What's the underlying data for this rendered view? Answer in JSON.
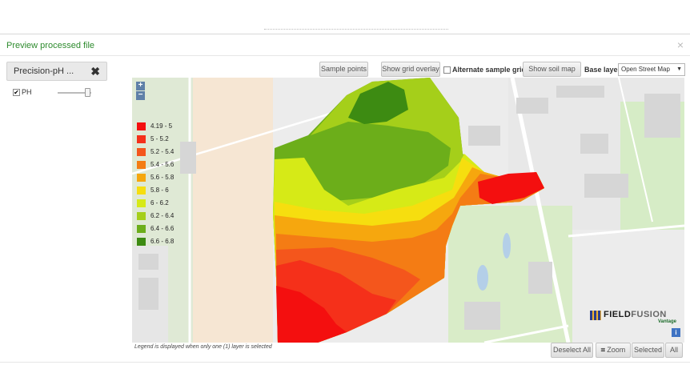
{
  "modal": {
    "title": "Preview processed file",
    "close_glyph": "×"
  },
  "layer": {
    "name": "Precision-pH ...",
    "remove_glyph": "✖",
    "checkbox_label": "PH",
    "checkbox_checked": true
  },
  "toolbar": {
    "sample_points": "Sample points",
    "show_grid_overlay": "Show grid overlay",
    "alternate_sample_grid": "Alternate sample grid",
    "show_soil_map": "Show soil map",
    "base_layer_label": "Base layer:",
    "base_layer_value": "Open Street Map"
  },
  "map": {
    "zoom_in": "+",
    "zoom_out": "−",
    "legend": [
      {
        "label": "4.19 - 5",
        "color": "#f40f0f"
      },
      {
        "label": "5 - 5.2",
        "color": "#f5301a"
      },
      {
        "label": "5.2 - 5.4",
        "color": "#f4561c"
      },
      {
        "label": "5.4 - 5.6",
        "color": "#f47c14"
      },
      {
        "label": "5.6 - 5.8",
        "color": "#f6a70e"
      },
      {
        "label": "5.8 - 6",
        "color": "#f6de0f"
      },
      {
        "label": "6 - 6.2",
        "color": "#d6ea17"
      },
      {
        "label": "6.2 - 6.4",
        "color": "#a5cf1a"
      },
      {
        "label": "6.4 - 6.6",
        "color": "#6cae1a"
      },
      {
        "label": "6.6 - 6.8",
        "color": "#3d8b12"
      }
    ],
    "brand_main": "FIELD",
    "brand_accent": "FUSION",
    "brand_sub": "Vantage",
    "info_glyph": "i"
  },
  "footer": {
    "legend_note": "Legend is displayed when only one (1) layer is selected",
    "deselect_all": "Deselect All",
    "zoom_label": "Zoom",
    "selected_label": "Selected",
    "all_label": "All"
  }
}
